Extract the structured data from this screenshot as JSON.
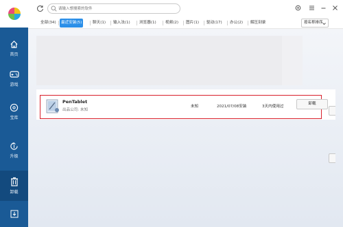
{
  "sidebar": {
    "logo_icon": "pinwheel-logo-icon",
    "items": [
      {
        "label": "首页",
        "icon": "home-icon"
      },
      {
        "label": "游戏",
        "icon": "gamepad-icon"
      },
      {
        "label": "宝库",
        "icon": "disc-icon"
      },
      {
        "label": "升级",
        "icon": "upgrade-icon"
      },
      {
        "label": "卸载",
        "icon": "trash-icon",
        "active": true
      },
      {
        "label": "",
        "icon": "download-icon"
      }
    ]
  },
  "search": {
    "placeholder": "请输入想搜索的软件"
  },
  "tabs": [
    {
      "label": "全部(34)"
    },
    {
      "label": "最近安装(5)",
      "active": true
    },
    {
      "label": "聊天(1)"
    },
    {
      "label": "输入法(1)"
    },
    {
      "label": "浏览器(1)"
    },
    {
      "label": "视频(2)"
    },
    {
      "label": "图片(1)"
    },
    {
      "label": "驱动(17)"
    },
    {
      "label": "办公(2)"
    },
    {
      "label": "解压刻录"
    }
  ],
  "sort": {
    "label": "按名称排序"
  },
  "app": {
    "name": "PenTablet",
    "publisher": "出品公司: 未知",
    "size": "未知",
    "install_date": "2021/07/08安装",
    "last_used": "3天内使用过",
    "uninstall_label": "卸载"
  },
  "colors": {
    "sidebar": "#1a5a96",
    "accent": "#2b8fe8",
    "highlight": "#d81e2a"
  }
}
